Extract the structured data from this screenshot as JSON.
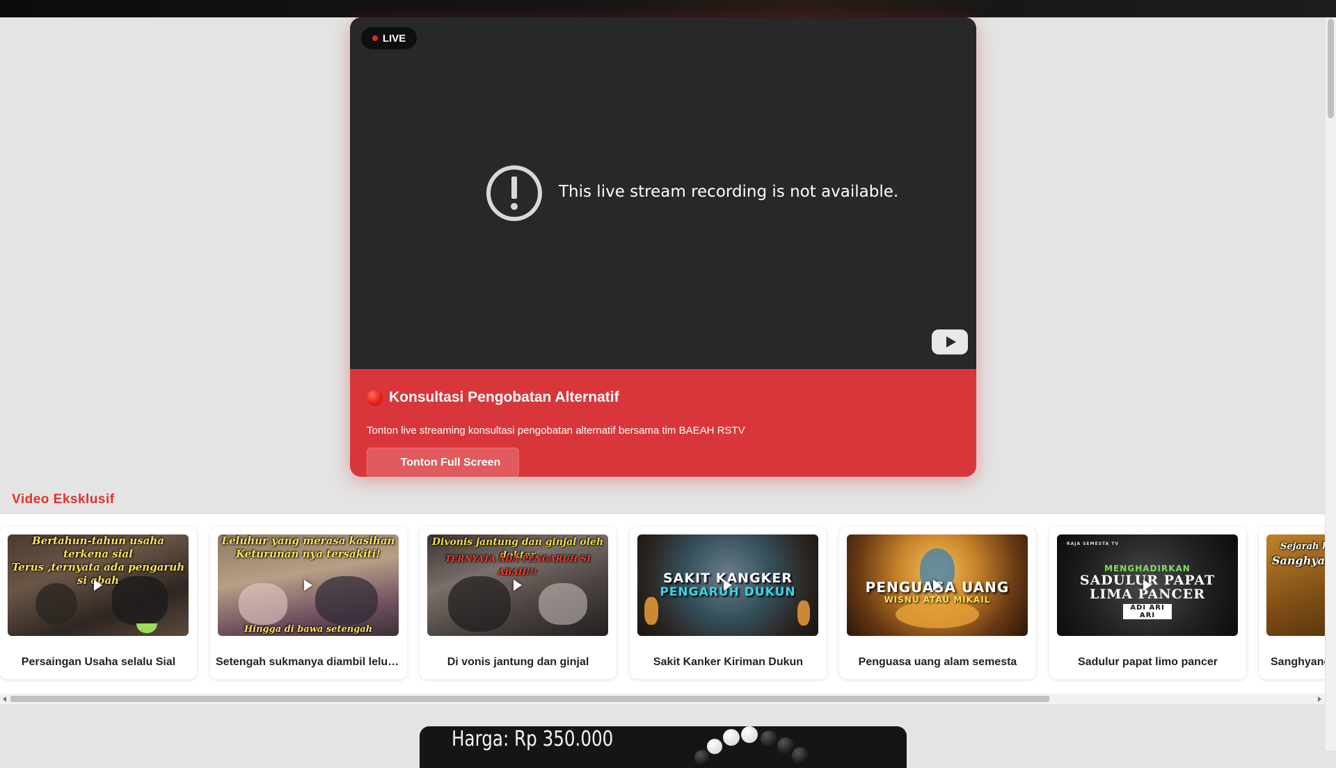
{
  "player": {
    "live_label": "LIVE",
    "error_message": "This live stream recording is not available."
  },
  "info": {
    "title": "Konsultasi Pengobatan Alternatif",
    "description": "Tonton live streaming konsultasi pengobatan alternatif bersama tim BAEAH RSTV",
    "fullscreen_button": "Tonton Full Screen"
  },
  "section": {
    "title": "Video Eksklusif"
  },
  "videos": [
    {
      "title": "Persaingan Usaha selalu Sial",
      "overlay_top": "Bertahun-tahun usaha terkena sial\nTerus ,ternyata ada pengaruh si abah"
    },
    {
      "title": "Setengah sukmanya diambil leluhur",
      "overlay_top": "Leluhur yang merasa kasihan\nKeturunan nya tersakiti!",
      "overlay_bottom": "Hingga di bawa setengah sukmanya"
    },
    {
      "title": "Di vonis jantung dan ginjal",
      "overlay_top": "Divonis jantung dan ginjal oleh dokter",
      "overlay_sub": "TERNYATA ADA PENGARUH SI ABAH!!!"
    },
    {
      "title": "Sakit Kanker Kiriman Dukun",
      "overlay_line1": "SAKIT KANGKER",
      "overlay_line2": "PENGARUH DUKUN"
    },
    {
      "title": "Penguasa uang alam semesta",
      "overlay_line1": "PENGUASA UANG",
      "overlay_line2": "WISNU ATAU MIKAIL"
    },
    {
      "title": "Sadulur papat limo pancer",
      "overlay_brand": "RAJA SEMESTA TV",
      "overlay_line0": "MENGHADIRKAN",
      "overlay_line1": "SADULUR PAPAT",
      "overlay_line2": "LIMA PANCER",
      "overlay_line3": "ADI ARI ARI"
    },
    {
      "title": "Sanghyang",
      "overlay_top": "Sejarah k",
      "overlay_sub": "Sanghyan"
    }
  ],
  "product": {
    "price": "Harga: Rp 350.000"
  },
  "colors": {
    "accent_red": "#d9363b",
    "section_title": "#e0312b",
    "player_bg": "#282828"
  }
}
